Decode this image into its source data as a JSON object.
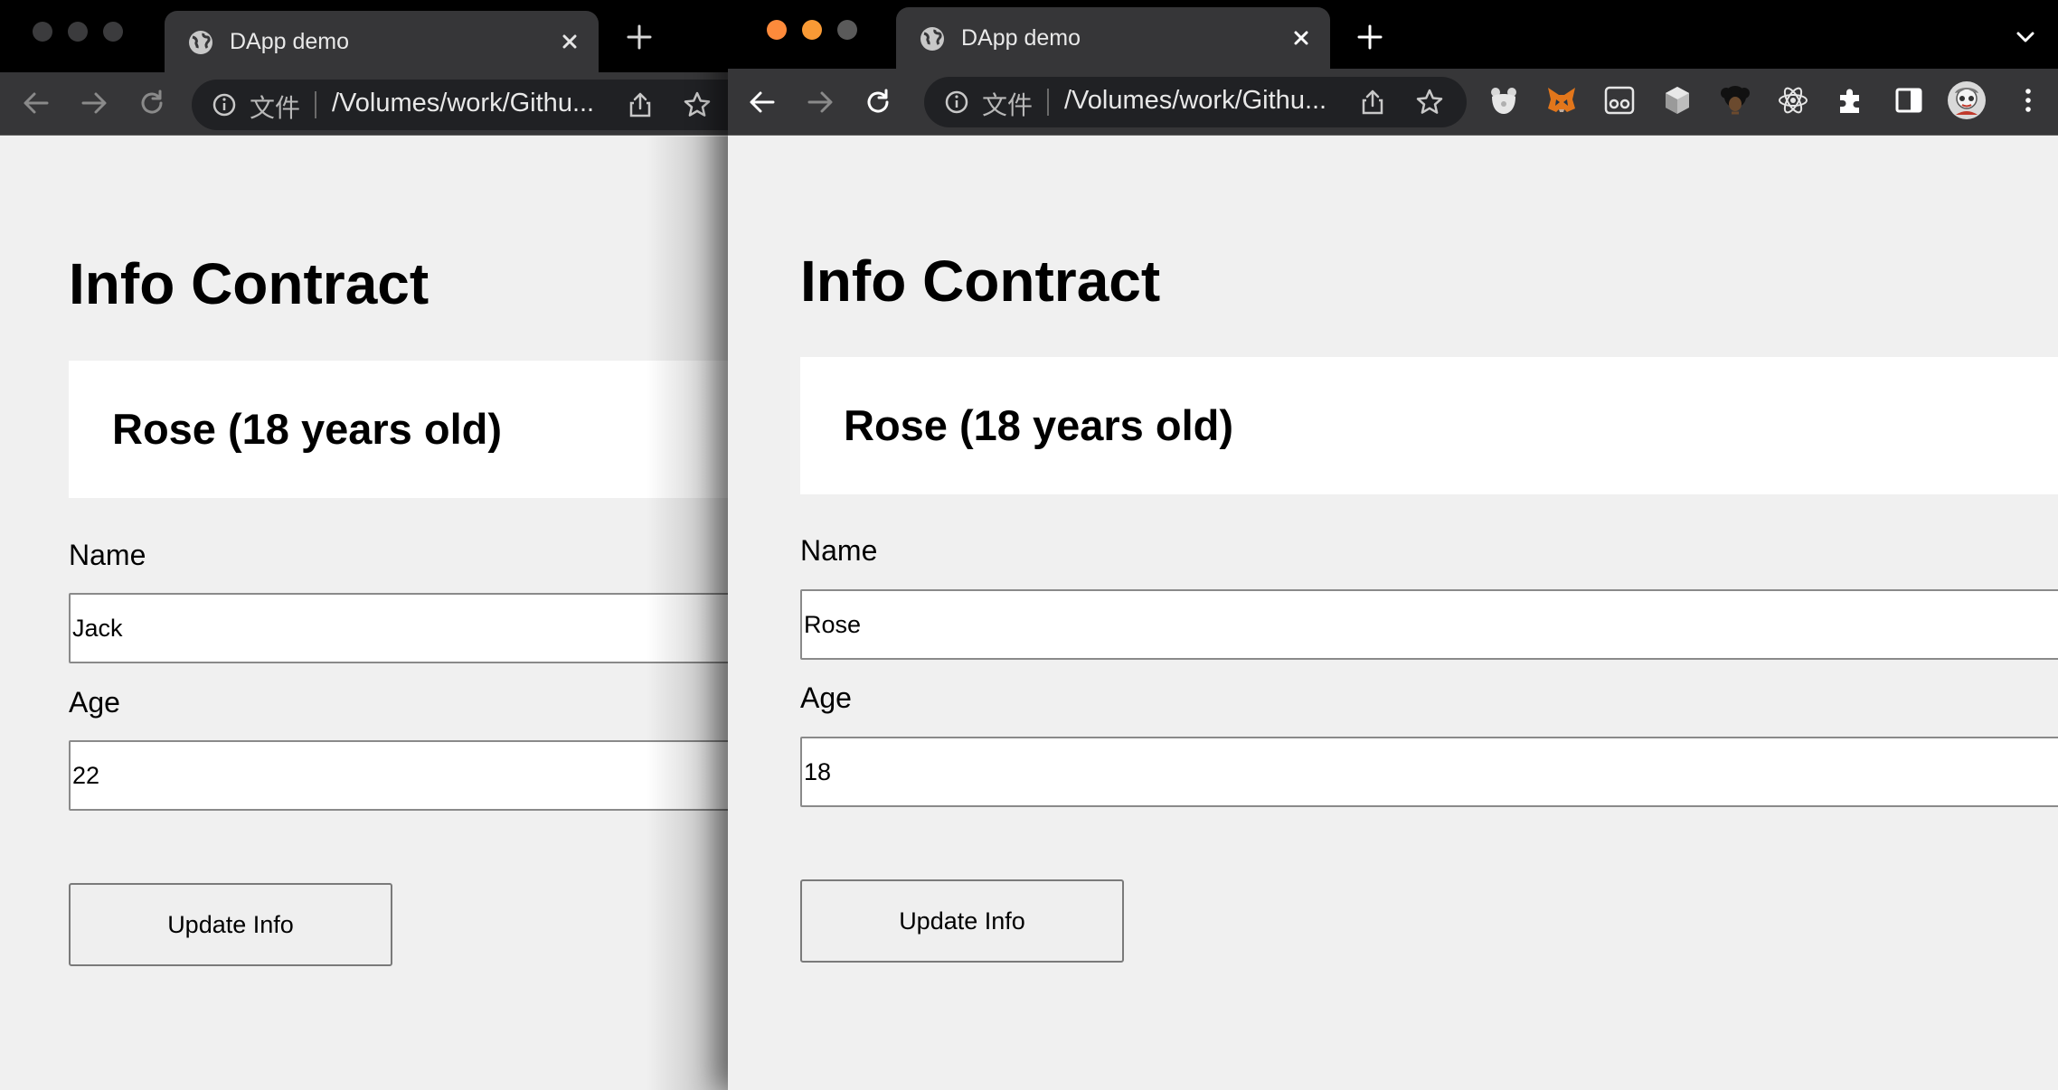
{
  "colors": {
    "tab_bg": "#363638",
    "tabstrip_bg": "#000000",
    "page_bg": "#f0f0f0",
    "card_bg": "#ffffff",
    "light_red_active": "#fd8a3b",
    "light_yellow_active": "#f99a35",
    "light_inactive": "#4a4a4a"
  },
  "windows": {
    "left": {
      "tab_title": "DApp demo",
      "omnibox": {
        "chip": "文件",
        "url": "/Volumes/work/Githu..."
      },
      "page": {
        "title": "Info Contract",
        "info": "Rose (18 years old)",
        "name_label": "Name",
        "name_value": "Jack",
        "age_label": "Age",
        "age_value": "22",
        "button_label": "Update Info"
      }
    },
    "right": {
      "tab_title": "DApp demo",
      "omnibox": {
        "chip": "文件",
        "url": "/Volumes/work/Githu..."
      },
      "extensions": [
        "bear-extension-icon",
        "metamask-fox-icon",
        "glasses-extension-icon",
        "cube-extension-icon",
        "afro-avatar-extension-icon",
        "react-devtools-icon",
        "puzzle-extensions-icon"
      ],
      "page": {
        "title": "Info Contract",
        "info": "Rose (18 years old)",
        "name_label": "Name",
        "name_value": "Rose",
        "age_label": "Age",
        "age_value": "18",
        "button_label": "Update Info"
      }
    }
  }
}
